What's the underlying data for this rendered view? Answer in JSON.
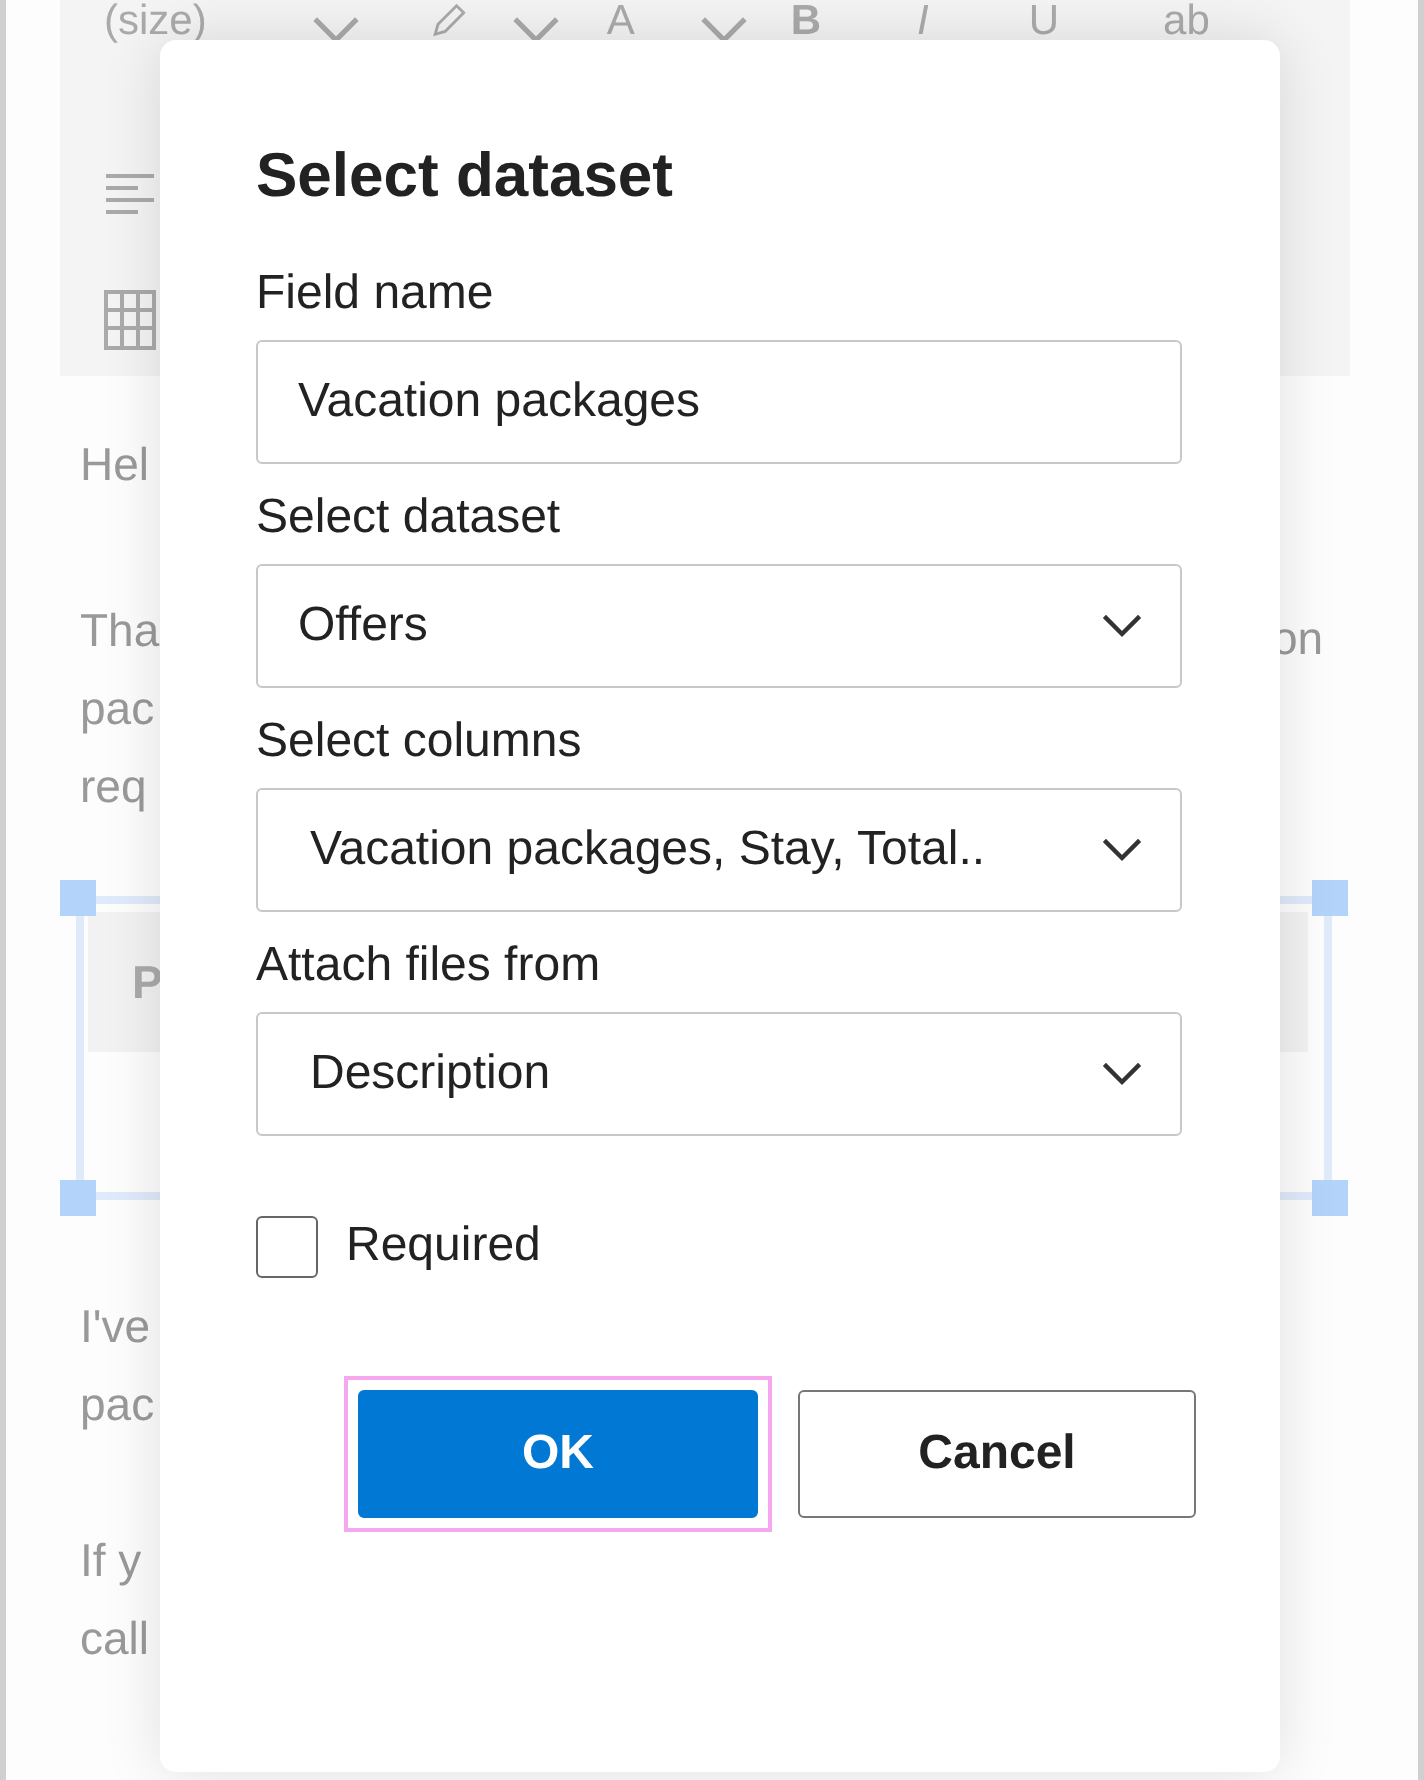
{
  "toolbar": {
    "font_size": "(size)",
    "font_color_letter": "A",
    "bold": "B",
    "italic": "I",
    "underline": "U",
    "strike": "ab"
  },
  "document": {
    "left_fragments": [
      "Hel",
      "Tha",
      "pac",
      "req"
    ],
    "right_fragment": "on",
    "table_header": "P",
    "after_table": [
      "I've",
      "pac"
    ],
    "closing": [
      "If y",
      "call"
    ]
  },
  "dialog": {
    "title": "Select dataset",
    "fields": [
      {
        "kind": "input",
        "label": "Field name",
        "value": "Vacation packages"
      },
      {
        "kind": "select",
        "label": "Select dataset",
        "value": "Offers"
      },
      {
        "kind": "select",
        "label": "Select columns",
        "value": "Vacation packages, Stay, Total.."
      },
      {
        "kind": "select",
        "label": "Attach files from",
        "value": "Description"
      }
    ],
    "required": {
      "label": "Required",
      "checked": false
    },
    "buttons": [
      {
        "label": "OK",
        "primary": true,
        "focused": true
      },
      {
        "label": "Cancel",
        "primary": false,
        "focused": false
      }
    ]
  }
}
